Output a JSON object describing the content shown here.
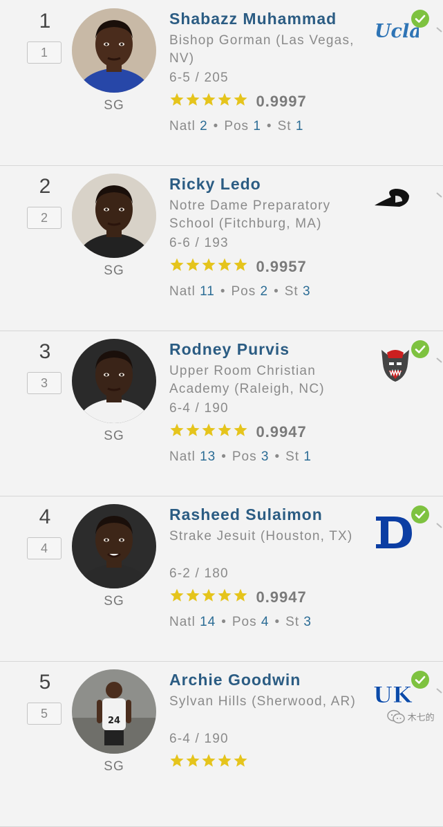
{
  "players": [
    {
      "rank": "1",
      "rank_box": "1",
      "position": "SG",
      "name": "Shabazz Muhammad",
      "school": "Bishop Gorman (Las Vegas, NV)",
      "height_weight": "6-5 / 205",
      "stars": 5,
      "rating": "0.9997",
      "natl_label": "Natl",
      "natl": "2",
      "pos_label": "Pos",
      "pos_rank": "1",
      "st_label": "St",
      "st": "1",
      "commit_logo": "ucla-logo",
      "committed": true
    },
    {
      "rank": "2",
      "rank_box": "2",
      "position": "SG",
      "name": "Ricky Ledo",
      "school": "Notre Dame Preparatory School (Fitchburg, MA)",
      "height_weight": "6-6 / 193",
      "stars": 5,
      "rating": "0.9957",
      "natl_label": "Natl",
      "natl": "11",
      "pos_label": "Pos",
      "pos_rank": "2",
      "st_label": "St",
      "st": "3",
      "commit_logo": "providence-friar-logo",
      "committed": false
    },
    {
      "rank": "3",
      "rank_box": "3",
      "position": "SG",
      "name": "Rodney Purvis",
      "school": "Upper Room Christian Academy (Raleigh, NC)",
      "height_weight": "6-4 / 190",
      "stars": 5,
      "rating": "0.9947",
      "natl_label": "Natl",
      "natl": "13",
      "pos_label": "Pos",
      "pos_rank": "3",
      "st_label": "St",
      "st": "1",
      "commit_logo": "nc-state-wolf-logo",
      "committed": true
    },
    {
      "rank": "4",
      "rank_box": "4",
      "position": "SG",
      "name": "Rasheed Sulaimon",
      "school": "Strake Jesuit (Houston, TX)",
      "height_weight": "6-2 / 180",
      "stars": 5,
      "rating": "0.9947",
      "natl_label": "Natl",
      "natl": "14",
      "pos_label": "Pos",
      "pos_rank": "4",
      "st_label": "St",
      "st": "3",
      "commit_logo": "duke-logo",
      "committed": true
    },
    {
      "rank": "5",
      "rank_box": "5",
      "position": "SG",
      "name": "Archie Goodwin",
      "school": "Sylvan Hills (Sherwood, AR)",
      "height_weight": "6-4 / 190",
      "stars": 5,
      "rating": "",
      "natl_label": "",
      "natl": "",
      "pos_label": "",
      "pos_rank": "",
      "st_label": "",
      "st": "",
      "commit_logo": "kentucky-logo",
      "committed": true
    }
  ],
  "watermark": {
    "text": "木七的",
    "icon": "wechat-icon"
  },
  "colors": {
    "name": "#2b5c83",
    "link_value": "#2b6c95",
    "star": "#e5c41c",
    "check": "#7ec240",
    "text_gray": "#8a8a8a",
    "background": "#f3f3f3"
  }
}
